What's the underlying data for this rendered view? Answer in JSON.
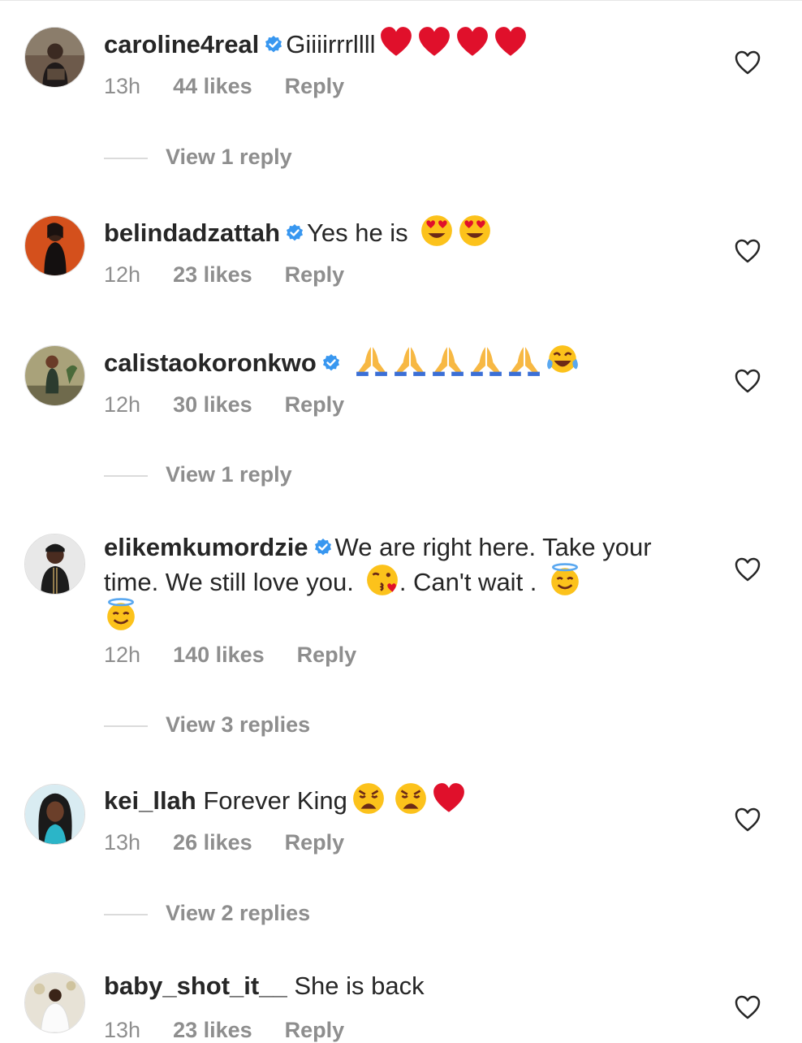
{
  "comments": [
    {
      "username": "caroline4real",
      "verified": true,
      "text": "Giiiirrrllll",
      "emojis": [
        "heart-emoji",
        "heart-emoji",
        "heart-emoji",
        "heart-emoji"
      ],
      "time": "13h",
      "likes": "44 likes",
      "reply": "Reply",
      "view_replies": "View 1 reply"
    },
    {
      "username": "belindadzattah",
      "verified": true,
      "text": "Yes he is",
      "emojis": [
        "heart-eyes-emoji",
        "heart-eyes-emoji"
      ],
      "time": "12h",
      "likes": "23 likes",
      "reply": "Reply"
    },
    {
      "username": "calistaokoronkwo",
      "verified": true,
      "text": "",
      "emojis": [
        "praying-hands-emoji",
        "praying-hands-emoji",
        "praying-hands-emoji",
        "praying-hands-emoji",
        "praying-hands-emoji",
        "tears-of-joy-emoji"
      ],
      "time": "12h",
      "likes": "30 likes",
      "reply": "Reply",
      "view_replies": "View 1 reply"
    },
    {
      "username": "elikemkumordzie",
      "verified": true,
      "text_a": "We are right here. Take your time. We still love you.",
      "text_b": ". Can't wait .",
      "emojis": [
        "kissing-heart-emoji",
        "halo-smile-emoji",
        "halo-smile-emoji"
      ],
      "time": "12h",
      "likes": "140 likes",
      "reply": "Reply",
      "view_replies": "View 3 replies"
    },
    {
      "username": "kei_llah",
      "verified": false,
      "text": "Forever King",
      "emojis": [
        "weary-face-emoji",
        "weary-face-emoji",
        "heart-emoji"
      ],
      "time": "13h",
      "likes": "26 likes",
      "reply": "Reply",
      "view_replies": "View 2 replies"
    },
    {
      "username": "baby_shot_it__",
      "verified": false,
      "text": "She is back",
      "time": "13h",
      "likes": "23 likes",
      "reply": "Reply"
    }
  ],
  "colors": {
    "text": "#262626",
    "secondary": "#8e8e8e",
    "verified": "#3897f0"
  }
}
